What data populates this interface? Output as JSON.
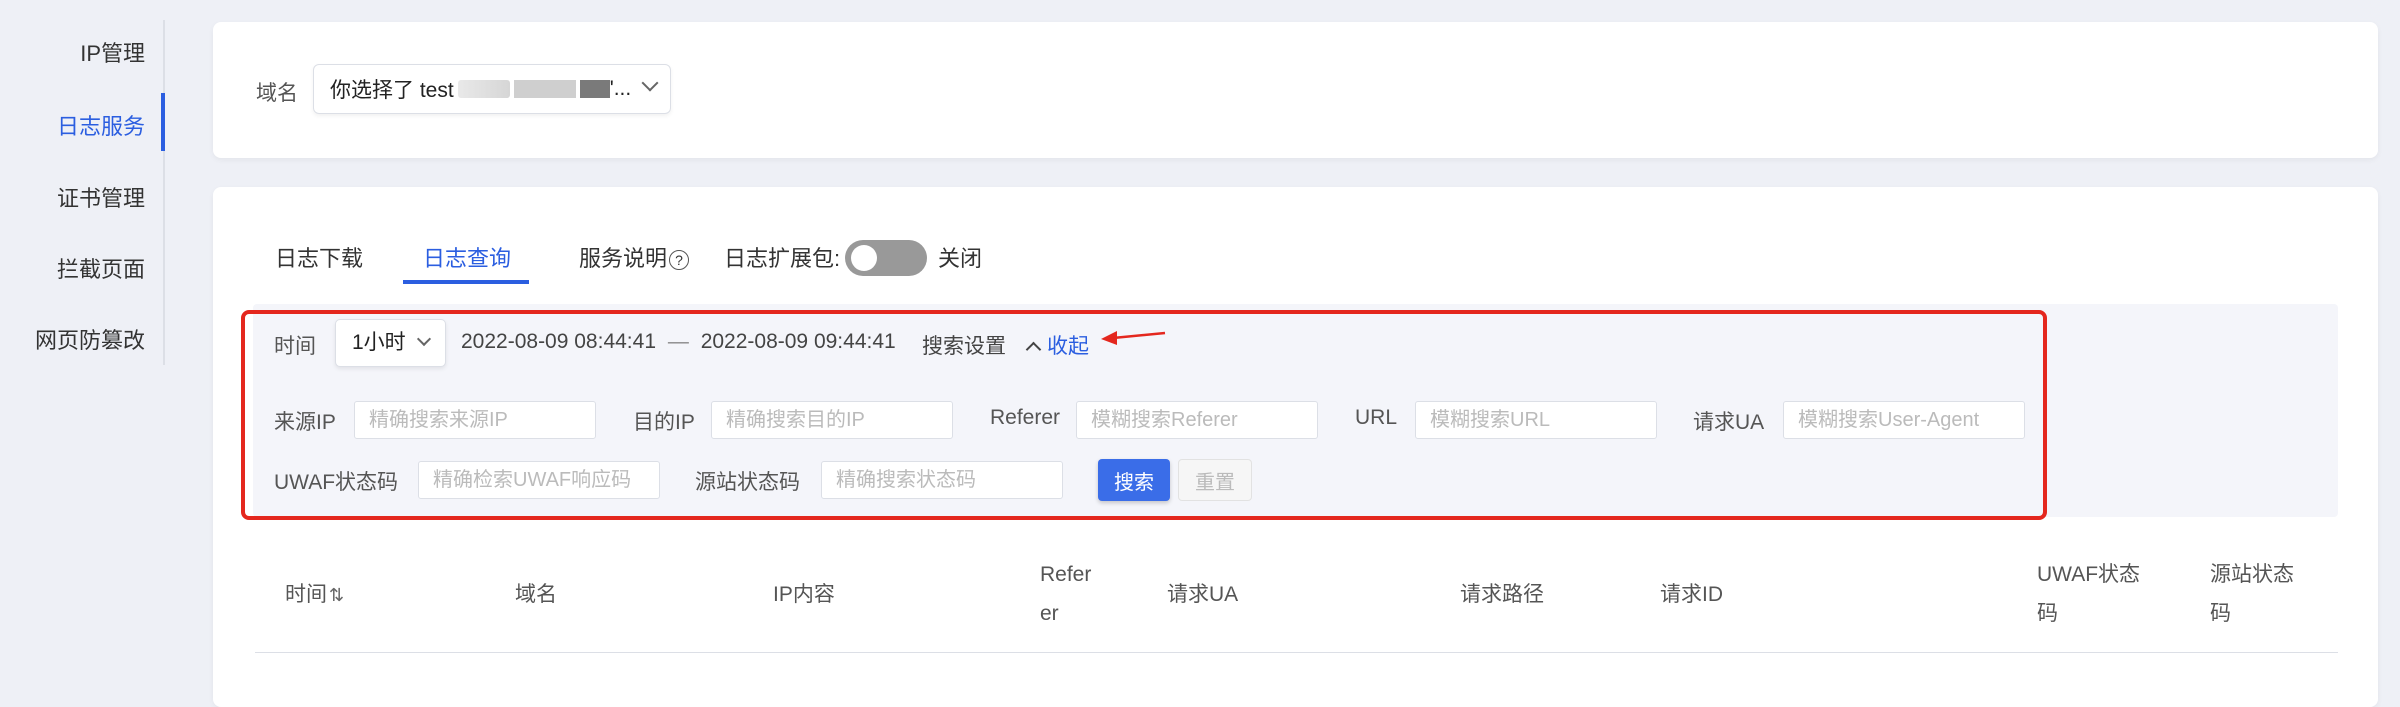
{
  "sidebar": {
    "items": [
      {
        "label": "IP管理",
        "active": false
      },
      {
        "label": "日志服务",
        "active": true
      },
      {
        "label": "证书管理",
        "active": false
      },
      {
        "label": "拦截页面",
        "active": false
      },
      {
        "label": "网页防篡改",
        "active": false
      }
    ]
  },
  "domain": {
    "label": "域名",
    "selected_prefix": "你选择了 test",
    "selected_suffix": "'..."
  },
  "tabs": [
    {
      "label": "日志下载",
      "active": false
    },
    {
      "label": "日志查询",
      "active": true
    }
  ],
  "service_note": "服务说明",
  "extension_pack": {
    "label": "日志扩展包:",
    "state_label": "关闭",
    "enabled": false
  },
  "filter": {
    "time_label": "时间",
    "time_range_option": "1小时",
    "start_time": "2022-08-09 08:44:41",
    "separator": "—",
    "end_time": "2022-08-09 09:44:41",
    "search_settings": "搜索设置",
    "collapse": "收起",
    "fields": [
      {
        "label": "来源IP",
        "placeholder": "精确搜索来源IP"
      },
      {
        "label": "目的IP",
        "placeholder": "精确搜索目的IP"
      },
      {
        "label": "Referer",
        "placeholder": "模糊搜索Referer"
      },
      {
        "label": "URL",
        "placeholder": "模糊搜索URL"
      },
      {
        "label": "请求UA",
        "placeholder": "模糊搜索User-Agent"
      },
      {
        "label": "UWAF状态码",
        "placeholder": "精确检索UWAF响应码"
      },
      {
        "label": "源站状态码",
        "placeholder": "精确搜索状态码"
      }
    ],
    "search_button": "搜索",
    "reset_button": "重置",
    "highlight_color": "#e4271e"
  },
  "table": {
    "headers": {
      "time": "时间",
      "domain": "域名",
      "ip": "IP内容",
      "referer_1": "Refer",
      "referer_2": "er",
      "ua": "请求UA",
      "path": "请求路径",
      "request_id": "请求ID",
      "uwaf_1": "UWAF状态",
      "uwaf_2": "码",
      "origin_1": "源站状态",
      "origin_2": "码"
    }
  },
  "colors": {
    "accent": "#2b5ee0",
    "background": "#eef0f6"
  }
}
